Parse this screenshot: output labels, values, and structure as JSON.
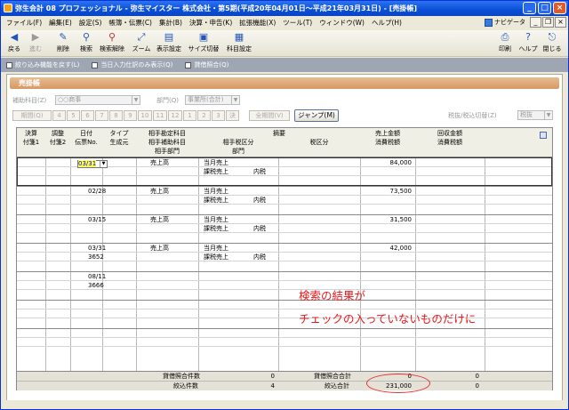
{
  "window": {
    "title": "弥生会計 08 プロフェッショナル - 弥生マイスター 株式会社・第5期(平成20年04月01日～平成21年03月31日) - [売掛帳]"
  },
  "menu": [
    "ファイル(F)",
    "編集(E)",
    "設定(S)",
    "帳簿・伝票(C)",
    "集計(B)",
    "決算・申告(K)",
    "拡張機能(X)",
    "ツール(T)",
    "ウィンドウ(W)",
    "ヘルプ(H)"
  ],
  "navi": "ナビゲータ",
  "toolbar": [
    "戻る",
    "進む",
    "削除",
    "検索",
    "検索解除",
    "ズーム",
    "表示設定",
    "サイズ切替",
    "科目設定"
  ],
  "toolbar_right": [
    "印刷",
    "ヘルプ",
    "閉じる"
  ],
  "subtoolbar": [
    "絞り込み機能を戻す(L)",
    "当日入力仕訳のみ表示(Q)",
    "貸借照合(Q)"
  ],
  "section_title": "売掛帳",
  "filter": {
    "label_sub": "補助科目(Z)",
    "sub_value": "○○商事",
    "label_dept": "部門(Q)",
    "dept_value": "事業所(合計)"
  },
  "months": [
    "期間(Q)",
    "4",
    "5",
    "6",
    "7",
    "8",
    "9",
    "10",
    "11",
    "12",
    "1",
    "2",
    "3",
    "決",
    "全期間(V)"
  ],
  "jump": "ジャンプ(M)",
  "tax": {
    "label": "税抜/税込切替(Z)",
    "value": "税抜"
  },
  "headers": {
    "settle": "決算",
    "fusen1": "付箋1",
    "chosa": "調整",
    "fusen2": "付箋2",
    "date": "日付",
    "voucher": "伝票No.",
    "type": "タイプ",
    "origin": "生成元",
    "acct": "相手勘定科目",
    "subacct": "相手補助科目",
    "dept": "相手部門",
    "memo": "摘要",
    "taxkbn_other": "相手税区分",
    "taxkbn": "税区分",
    "dept2": "部門",
    "sales": "売上金額",
    "tax": "消費税額",
    "collect": "回収金額",
    "tax2": "消費税額"
  },
  "rows": [
    {
      "date": "03/31",
      "voucher": "",
      "acct": "売上高",
      "memo": "当月売上",
      "taxother": "課税売上",
      "taxkbn": "内税",
      "amount": "84,000"
    },
    {
      "date": "02/28",
      "voucher": "",
      "acct": "売上高",
      "memo": "当月売上",
      "taxother": "課税売上",
      "taxkbn": "内税",
      "amount": "73,500"
    },
    {
      "date": "03/15",
      "voucher": "",
      "acct": "売上高",
      "memo": "当月売上",
      "taxother": "課税売上",
      "taxkbn": "内税",
      "amount": "31,500"
    },
    {
      "date": "03/31",
      "voucher": "3652",
      "acct": "売上高",
      "memo": "当月売上",
      "taxother": "課税売上",
      "taxkbn": "内税",
      "amount": "42,000"
    },
    {
      "date": "08/11",
      "voucher": "3666",
      "acct": "",
      "memo": "",
      "taxother": "",
      "taxkbn": "",
      "amount": ""
    }
  ],
  "footer": {
    "count_label": "貸借照合件数",
    "count_value": "0",
    "sum_label": "貸借照合合計",
    "sum_value": "0",
    "sum_tax": "0",
    "filter_count_label": "絞込件数",
    "filter_count_value": "4",
    "filter_sum_label": "絞込合計",
    "filter_sum_value": "231,000",
    "filter_sum_tax": "0"
  },
  "annotation": {
    "line1": "検索の結果が",
    "line2": "チェックの入っていないものだけに",
    "color": "#e5191c"
  },
  "colors": {
    "title": "#0a4ed6",
    "section": "#d69a64",
    "subtoolbar": "#9fa6b3"
  }
}
